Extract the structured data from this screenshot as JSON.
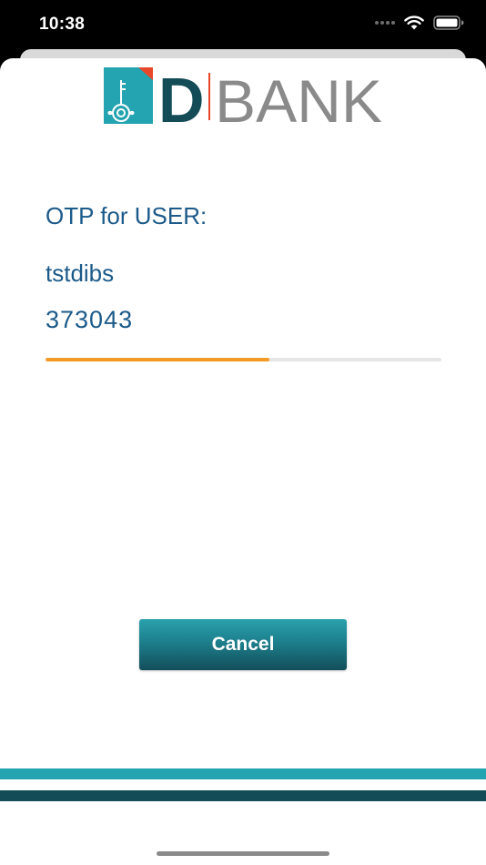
{
  "status_bar": {
    "time": "10:38",
    "icons": [
      "signal-dots-icon",
      "wifi-icon",
      "battery-icon"
    ]
  },
  "logo": {
    "brand_letter": "D",
    "brand_word": "BANK",
    "icon": "key-emblem-icon"
  },
  "otp": {
    "label": "OTP for USER:",
    "username": "tstdibs",
    "code": "373043",
    "progress_fraction": 0.565
  },
  "actions": {
    "cancel_label": "Cancel"
  },
  "colors": {
    "text_blue": "#1c5a8a",
    "progress_orange": "#f39a26",
    "teal": "#24a3b0",
    "dark_teal": "#134b57",
    "accent_red": "#e8472a"
  }
}
